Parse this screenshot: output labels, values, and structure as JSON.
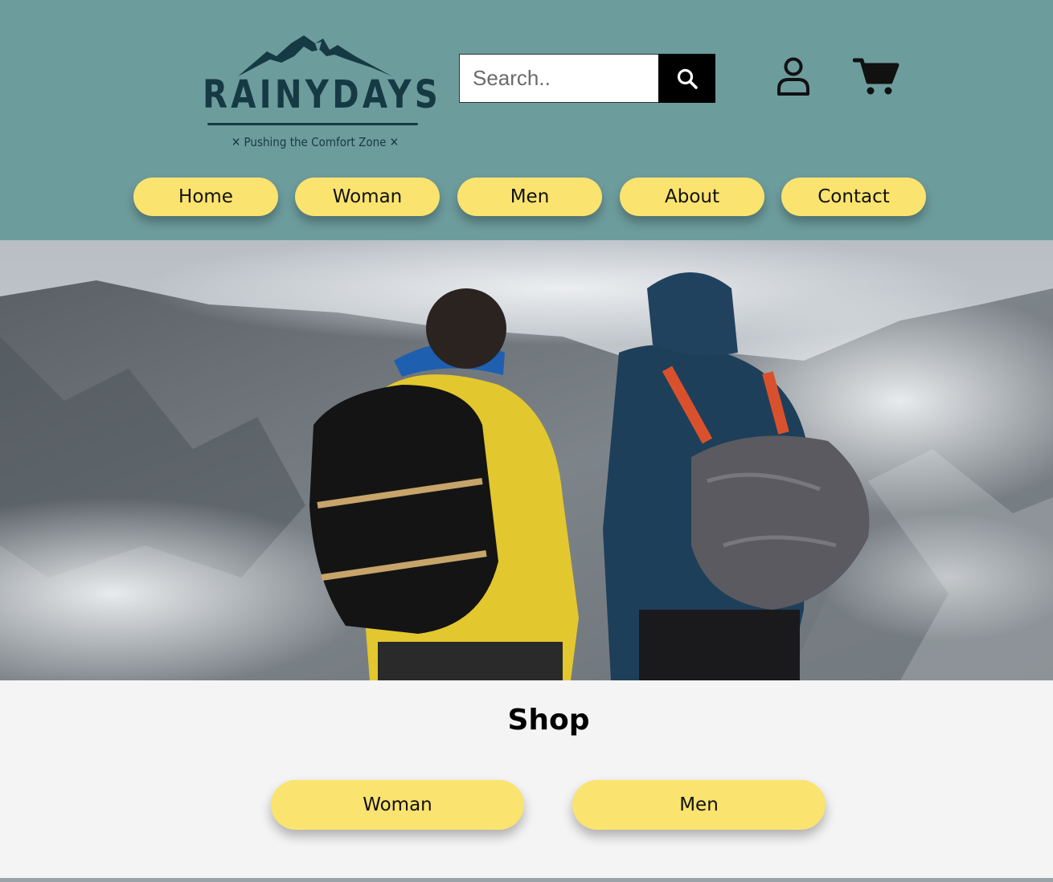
{
  "brand": {
    "name": "RAINYDAYS",
    "tagline": "✕ Pushing the Comfort Zone ✕"
  },
  "search": {
    "placeholder": "Search.."
  },
  "icons": {
    "search": "search-icon",
    "account": "user-icon",
    "cart": "cart-icon"
  },
  "nav": {
    "items": [
      {
        "label": "Home"
      },
      {
        "label": "Woman"
      },
      {
        "label": "Men"
      },
      {
        "label": "About"
      },
      {
        "label": "Contact"
      }
    ]
  },
  "shop": {
    "title": "Shop",
    "buttons": [
      {
        "label": "Woman"
      },
      {
        "label": "Men"
      }
    ]
  },
  "colors": {
    "header_bg": "#6d9c9d",
    "button_yellow": "#fae36f",
    "brand_dark": "#163a44",
    "page_bg": "#f4f4f4"
  }
}
